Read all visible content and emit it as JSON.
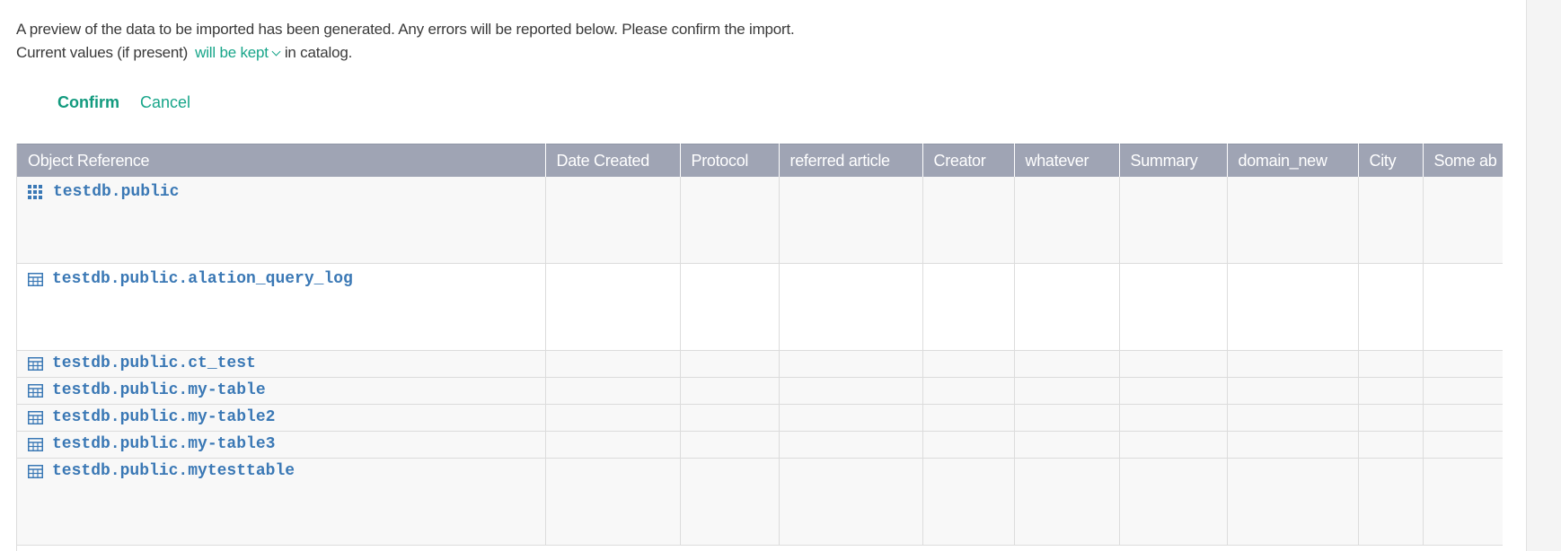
{
  "intro": {
    "line1": "A preview of the data to be imported has been generated. Any errors will be reported below. Please confirm the import.",
    "line2_prefix": "Current values (if present)",
    "kept_option": "will be kept",
    "line2_suffix": "in catalog."
  },
  "actions": {
    "confirm_label": "Confirm",
    "cancel_label": "Cancel"
  },
  "colors": {
    "accent": "#17a589",
    "header_bg": "#9fa4b4",
    "link": "#3a78b5"
  },
  "table": {
    "columns": [
      "Object Reference",
      "Date Created",
      "Protocol",
      "referred article",
      "Creator",
      "whatever",
      "Summary",
      "domain_new",
      "City",
      "Some ab"
    ],
    "rows": [
      {
        "icon": "schema-grid-icon",
        "ref": "testdb.public"
      },
      {
        "icon": "table-icon",
        "ref": "testdb.public.alation_query_log"
      },
      {
        "icon": "table-icon",
        "ref": "testdb.public.ct_test"
      },
      {
        "icon": "table-icon",
        "ref": "testdb.public.my-table"
      },
      {
        "icon": "table-icon",
        "ref": "testdb.public.my-table2"
      },
      {
        "icon": "table-icon",
        "ref": "testdb.public.my-table3"
      },
      {
        "icon": "table-icon",
        "ref": "testdb.public.mytesttable"
      }
    ]
  }
}
